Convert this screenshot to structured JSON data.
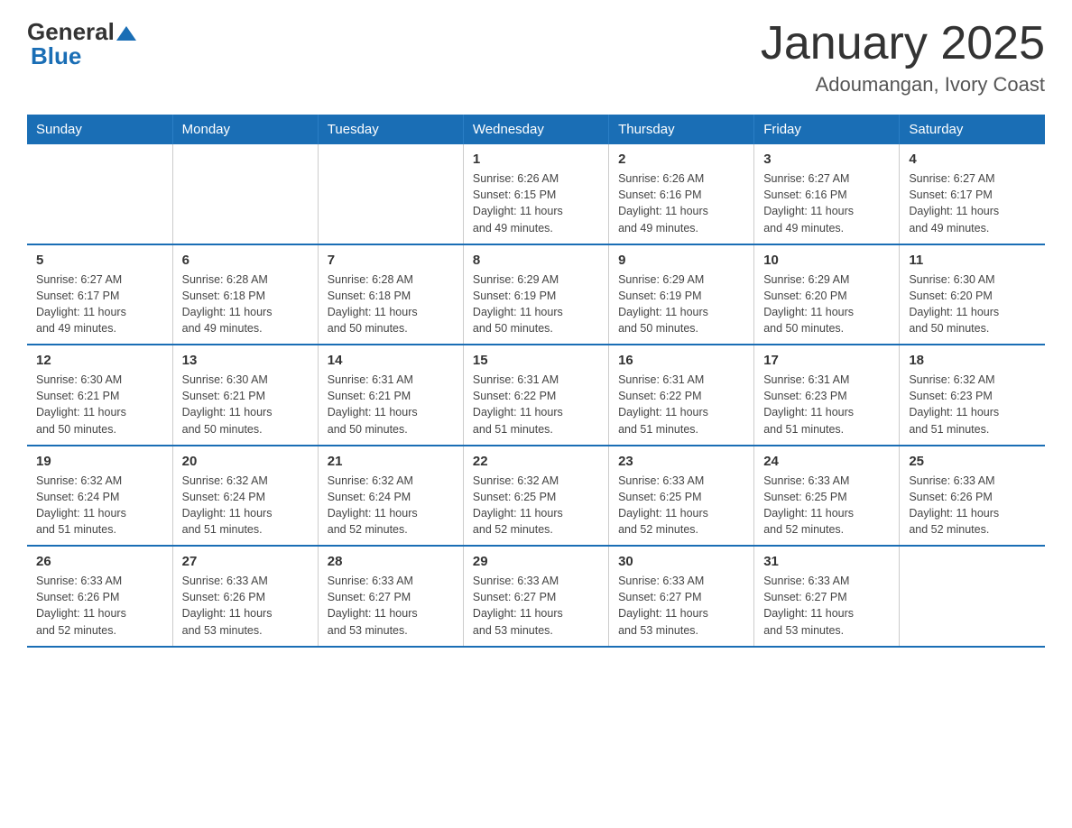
{
  "logo": {
    "general": "General",
    "blue": "Blue"
  },
  "title": "January 2025",
  "subtitle": "Adoumangan, Ivory Coast",
  "days_of_week": [
    "Sunday",
    "Monday",
    "Tuesday",
    "Wednesday",
    "Thursday",
    "Friday",
    "Saturday"
  ],
  "weeks": [
    [
      {
        "day": "",
        "info": ""
      },
      {
        "day": "",
        "info": ""
      },
      {
        "day": "",
        "info": ""
      },
      {
        "day": "1",
        "info": "Sunrise: 6:26 AM\nSunset: 6:15 PM\nDaylight: 11 hours\nand 49 minutes."
      },
      {
        "day": "2",
        "info": "Sunrise: 6:26 AM\nSunset: 6:16 PM\nDaylight: 11 hours\nand 49 minutes."
      },
      {
        "day": "3",
        "info": "Sunrise: 6:27 AM\nSunset: 6:16 PM\nDaylight: 11 hours\nand 49 minutes."
      },
      {
        "day": "4",
        "info": "Sunrise: 6:27 AM\nSunset: 6:17 PM\nDaylight: 11 hours\nand 49 minutes."
      }
    ],
    [
      {
        "day": "5",
        "info": "Sunrise: 6:27 AM\nSunset: 6:17 PM\nDaylight: 11 hours\nand 49 minutes."
      },
      {
        "day": "6",
        "info": "Sunrise: 6:28 AM\nSunset: 6:18 PM\nDaylight: 11 hours\nand 49 minutes."
      },
      {
        "day": "7",
        "info": "Sunrise: 6:28 AM\nSunset: 6:18 PM\nDaylight: 11 hours\nand 50 minutes."
      },
      {
        "day": "8",
        "info": "Sunrise: 6:29 AM\nSunset: 6:19 PM\nDaylight: 11 hours\nand 50 minutes."
      },
      {
        "day": "9",
        "info": "Sunrise: 6:29 AM\nSunset: 6:19 PM\nDaylight: 11 hours\nand 50 minutes."
      },
      {
        "day": "10",
        "info": "Sunrise: 6:29 AM\nSunset: 6:20 PM\nDaylight: 11 hours\nand 50 minutes."
      },
      {
        "day": "11",
        "info": "Sunrise: 6:30 AM\nSunset: 6:20 PM\nDaylight: 11 hours\nand 50 minutes."
      }
    ],
    [
      {
        "day": "12",
        "info": "Sunrise: 6:30 AM\nSunset: 6:21 PM\nDaylight: 11 hours\nand 50 minutes."
      },
      {
        "day": "13",
        "info": "Sunrise: 6:30 AM\nSunset: 6:21 PM\nDaylight: 11 hours\nand 50 minutes."
      },
      {
        "day": "14",
        "info": "Sunrise: 6:31 AM\nSunset: 6:21 PM\nDaylight: 11 hours\nand 50 minutes."
      },
      {
        "day": "15",
        "info": "Sunrise: 6:31 AM\nSunset: 6:22 PM\nDaylight: 11 hours\nand 51 minutes."
      },
      {
        "day": "16",
        "info": "Sunrise: 6:31 AM\nSunset: 6:22 PM\nDaylight: 11 hours\nand 51 minutes."
      },
      {
        "day": "17",
        "info": "Sunrise: 6:31 AM\nSunset: 6:23 PM\nDaylight: 11 hours\nand 51 minutes."
      },
      {
        "day": "18",
        "info": "Sunrise: 6:32 AM\nSunset: 6:23 PM\nDaylight: 11 hours\nand 51 minutes."
      }
    ],
    [
      {
        "day": "19",
        "info": "Sunrise: 6:32 AM\nSunset: 6:24 PM\nDaylight: 11 hours\nand 51 minutes."
      },
      {
        "day": "20",
        "info": "Sunrise: 6:32 AM\nSunset: 6:24 PM\nDaylight: 11 hours\nand 51 minutes."
      },
      {
        "day": "21",
        "info": "Sunrise: 6:32 AM\nSunset: 6:24 PM\nDaylight: 11 hours\nand 52 minutes."
      },
      {
        "day": "22",
        "info": "Sunrise: 6:32 AM\nSunset: 6:25 PM\nDaylight: 11 hours\nand 52 minutes."
      },
      {
        "day": "23",
        "info": "Sunrise: 6:33 AM\nSunset: 6:25 PM\nDaylight: 11 hours\nand 52 minutes."
      },
      {
        "day": "24",
        "info": "Sunrise: 6:33 AM\nSunset: 6:25 PM\nDaylight: 11 hours\nand 52 minutes."
      },
      {
        "day": "25",
        "info": "Sunrise: 6:33 AM\nSunset: 6:26 PM\nDaylight: 11 hours\nand 52 minutes."
      }
    ],
    [
      {
        "day": "26",
        "info": "Sunrise: 6:33 AM\nSunset: 6:26 PM\nDaylight: 11 hours\nand 52 minutes."
      },
      {
        "day": "27",
        "info": "Sunrise: 6:33 AM\nSunset: 6:26 PM\nDaylight: 11 hours\nand 53 minutes."
      },
      {
        "day": "28",
        "info": "Sunrise: 6:33 AM\nSunset: 6:27 PM\nDaylight: 11 hours\nand 53 minutes."
      },
      {
        "day": "29",
        "info": "Sunrise: 6:33 AM\nSunset: 6:27 PM\nDaylight: 11 hours\nand 53 minutes."
      },
      {
        "day": "30",
        "info": "Sunrise: 6:33 AM\nSunset: 6:27 PM\nDaylight: 11 hours\nand 53 minutes."
      },
      {
        "day": "31",
        "info": "Sunrise: 6:33 AM\nSunset: 6:27 PM\nDaylight: 11 hours\nand 53 minutes."
      },
      {
        "day": "",
        "info": ""
      }
    ]
  ]
}
